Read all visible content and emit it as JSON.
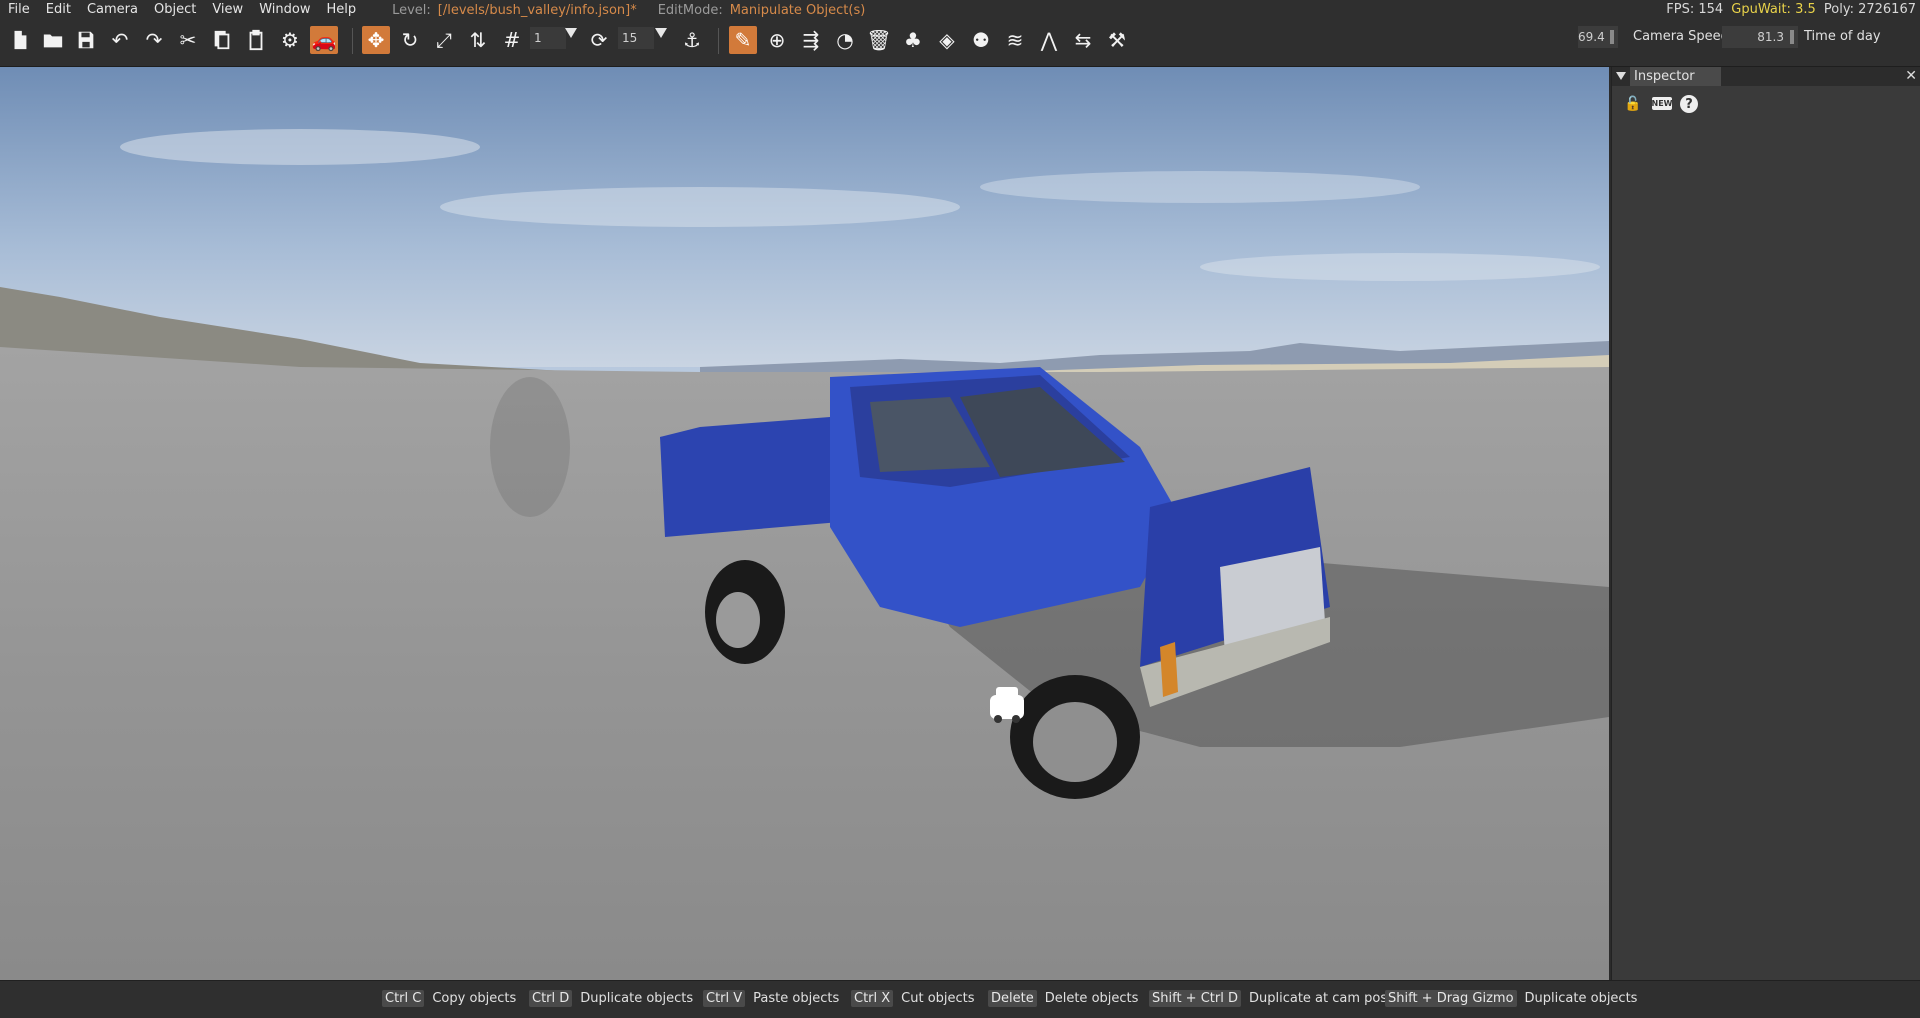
{
  "menu": {
    "items": [
      "File",
      "Edit",
      "Camera",
      "Object",
      "View",
      "Window",
      "Help"
    ],
    "level_label": "Level:",
    "level_value": "[/levels/bush_valley/info.json]*",
    "editmode_label": "EditMode:",
    "editmode_value": "Manipulate Object(s)"
  },
  "stats": {
    "fps": "FPS: 154",
    "gpuwait": "GpuWait: 3.5",
    "poly": "Poly: 2726167"
  },
  "toolbar": {
    "grid_size": "1",
    "rotate_step": "15",
    "fov_value": "69.4",
    "camera_speed_label": "Camera Speed",
    "camera_speed_value": "81.3",
    "time_of_day_label": "Time of day"
  },
  "inspector": {
    "title": "Inspector",
    "new_label": "NEW",
    "help_label": "?"
  },
  "shortcuts": [
    {
      "key": "Ctrl C",
      "action": "Copy objects"
    },
    {
      "key": "Ctrl D",
      "action": "Duplicate objects"
    },
    {
      "key": "Ctrl V",
      "action": "Paste objects"
    },
    {
      "key": "Ctrl X",
      "action": "Cut objects"
    },
    {
      "key": "Delete",
      "action": "Delete objects"
    },
    {
      "key": "Shift + Ctrl D",
      "action": "Duplicate at cam pos"
    },
    {
      "key": "Shift + Drag Gizmo",
      "action": "Duplicate objects"
    }
  ],
  "colors": {
    "accent": "#d27a3a",
    "truck": "#2f47b8"
  }
}
